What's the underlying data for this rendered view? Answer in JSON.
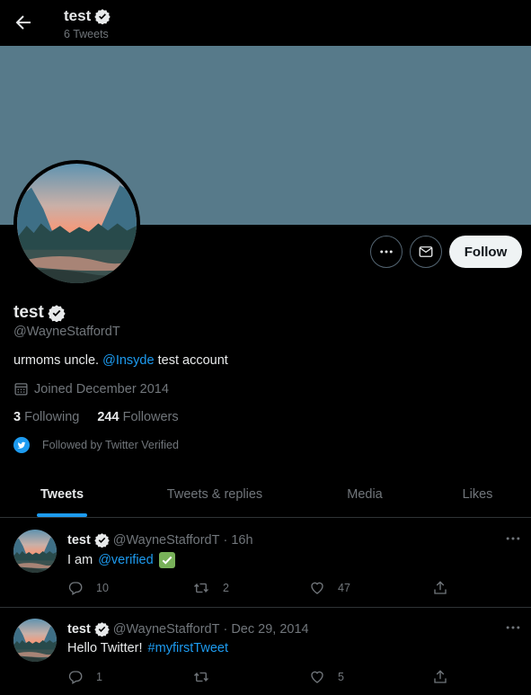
{
  "header": {
    "name": "test",
    "tweet_count": "6 Tweets"
  },
  "colors": {
    "banner": "#577a8a",
    "accent": "#1d9bf0",
    "follow_bg": "#eff3f4"
  },
  "profile": {
    "name": "test",
    "handle": "@WayneStaffordT",
    "bio_before": "urmoms uncle.",
    "bio_mention": "@Insyde",
    "bio_after": "test account",
    "joined": "Joined December 2014",
    "following_count": "3",
    "following_label": "Following",
    "followers_count": "244",
    "followers_label": "Followers",
    "followed_by": "Followed by Twitter Verified"
  },
  "actions": {
    "follow_label": "Follow"
  },
  "tabs": [
    {
      "label": "Tweets",
      "active": true
    },
    {
      "label": "Tweets & replies",
      "active": false
    },
    {
      "label": "Media",
      "active": false
    },
    {
      "label": "Likes",
      "active": false
    }
  ],
  "tweets": [
    {
      "name": "test",
      "handle": "@WayneStaffordT",
      "sep": "·",
      "time": "16h",
      "text": "I am",
      "link": "@verified",
      "emoji": "check-mark-emoji",
      "replies": "10",
      "retweets": "2",
      "likes": "47"
    },
    {
      "name": "test",
      "handle": "@WayneStaffordT",
      "sep": "·",
      "time": "Dec 29, 2014",
      "text": "Hello Twitter!",
      "link": "#myfirstTweet",
      "replies": "1",
      "retweets": "",
      "likes": "5"
    }
  ]
}
